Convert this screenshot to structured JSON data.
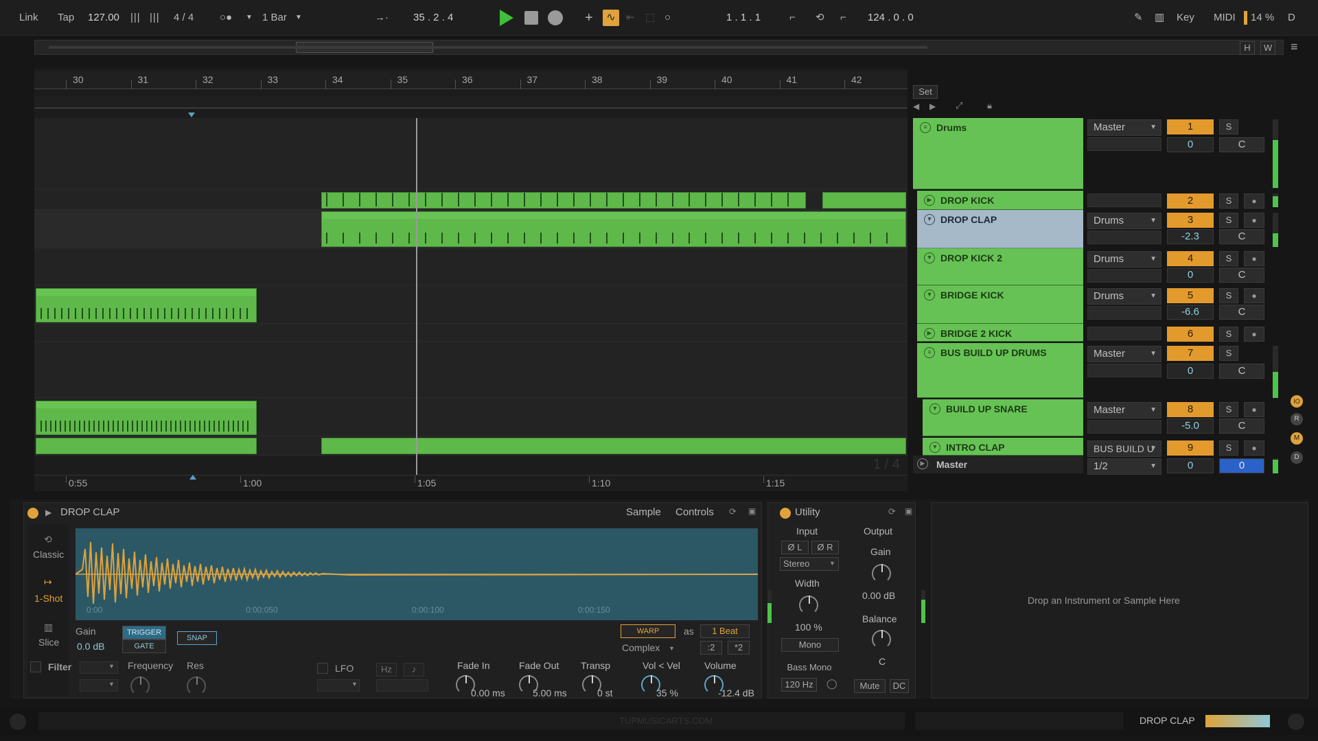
{
  "toolbar": {
    "link": "Link",
    "tap": "Tap",
    "tempo": "127.00",
    "signature": "4 / 4",
    "quantize": "1 Bar",
    "position": "35 .   2 .   4",
    "loop_start": "1 .   1 .   1",
    "loop_length": "124 .   0 .   0",
    "key": "Key",
    "midi": "MIDI",
    "cpu": "14 %",
    "d": "D"
  },
  "overview": {
    "h": "H",
    "w": "W"
  },
  "ruler": {
    "bars": [
      "30",
      "31",
      "32",
      "33",
      "34",
      "35",
      "36",
      "37",
      "38",
      "39",
      "40",
      "41",
      "42"
    ]
  },
  "set_button": "Set",
  "time_axis": [
    "0:55",
    "1:00",
    "1:05",
    "1:10",
    "1:15"
  ],
  "page_indicator": "1 / 4",
  "tracks": [
    {
      "name": "Drums",
      "output": "Master",
      "number": "1",
      "volume": "0",
      "pan": "C",
      "solo": "S"
    },
    {
      "name": "DROP KICK",
      "output": "",
      "number": "2",
      "volume": "",
      "pan": "",
      "solo": "S"
    },
    {
      "name": "DROP CLAP",
      "output": "Drums",
      "number": "3",
      "volume": "-2.3",
      "pan": "C",
      "solo": "S"
    },
    {
      "name": "DROP KICK 2",
      "output": "Drums",
      "number": "4",
      "volume": "0",
      "pan": "C",
      "solo": "S"
    },
    {
      "name": "BRIDGE KICK",
      "output": "Drums",
      "number": "5",
      "volume": "-6.6",
      "pan": "C",
      "solo": "S"
    },
    {
      "name": "BRIDGE 2 KICK",
      "output": "",
      "number": "6",
      "volume": "",
      "pan": "",
      "solo": "S"
    },
    {
      "name": "BUS BUILD UP DRUMS",
      "output": "Master",
      "number": "7",
      "volume": "0",
      "pan": "C",
      "solo": "S"
    },
    {
      "name": "BUILD UP SNARE",
      "output": "Master",
      "number": "8",
      "volume": "-5.0",
      "pan": "C",
      "solo": "S"
    },
    {
      "name": "INTRO CLAP",
      "output": "BUS BUILD U",
      "number": "9",
      "volume": "",
      "pan": "",
      "solo": "S"
    }
  ],
  "master": {
    "name": "Master",
    "output": "1/2",
    "volume": "0",
    "pan": "0"
  },
  "simpler": {
    "title": "DROP CLAP",
    "tab_sample": "Sample",
    "tab_controls": "Controls",
    "mode_classic": "Classic",
    "mode_oneshot": "1-Shot",
    "mode_slice": "Slice",
    "gain_label": "Gain",
    "gain_value": "0.0 dB",
    "trigger": "TRIGGER",
    "gate": "GATE",
    "snap": "SNAP",
    "warp": "WARP",
    "as": "as",
    "beat": "1 Beat",
    "complex": "Complex",
    "div2": ":2",
    "mul2": "*2",
    "time_marks": [
      "0:00",
      "0:00:050",
      "0:00:100",
      "0:00:150"
    ],
    "filter": "Filter",
    "frequency": "Frequency",
    "res": "Res",
    "lfo": "LFO",
    "hz": "Hz",
    "fade_in_label": "Fade In",
    "fade_in_value": "0.00 ms",
    "fade_out_label": "Fade Out",
    "fade_out_value": "5.00 ms",
    "transp_label": "Transp",
    "transp_value": "0 st",
    "volvel_label": "Vol < Vel",
    "volvel_value": "35 %",
    "volume_label": "Volume",
    "volume_value": "-12.4 dB"
  },
  "utility": {
    "title": "Utility",
    "input": "Input",
    "output": "Output",
    "phase_l": "Ø L",
    "phase_r": "Ø R",
    "stereo": "Stereo",
    "width_label": "Width",
    "width_value": "100 %",
    "mono": "Mono",
    "bass_mono": "Bass Mono",
    "bass_freq": "120 Hz",
    "gain_label": "Gain",
    "gain_value": "0.00 dB",
    "balance_label": "Balance",
    "balance_value": "C",
    "mute": "Mute",
    "dc": "DC"
  },
  "drop_zone": "Drop an Instrument or Sample Here",
  "status": {
    "watermark": "TUPMUSICARTS.COM",
    "selected_track": "DROP CLAP"
  },
  "colors": {
    "clip_green": "#5fb94a",
    "track_orange": "#e39a2d",
    "selected": "#a5b9c9",
    "play_green": "#3fbf3a",
    "sample_orange": "#e0a23a"
  }
}
